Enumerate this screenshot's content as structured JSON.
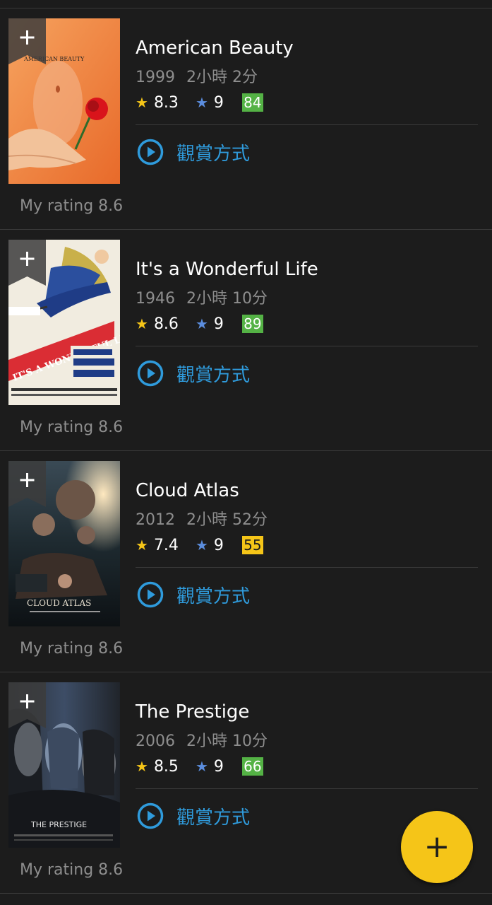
{
  "movies": [
    {
      "title": "American Beauty",
      "year": "1999",
      "runtime": "2小時 2分",
      "imdb_rating": "8.3",
      "user_rating": "9",
      "metascore": "84",
      "metascore_color": "#54b245",
      "watch_label": "觀賞方式",
      "my_rating": "My rating 8.6",
      "poster_text": "AMERICAN BEAUTY"
    },
    {
      "title": "It's a Wonderful Life",
      "year": "1946",
      "runtime": "2小時 10分",
      "imdb_rating": "8.6",
      "user_rating": "9",
      "metascore": "89",
      "metascore_color": "#54b245",
      "watch_label": "觀賞方式",
      "my_rating": "My rating 8.6",
      "poster_text": "IT'S A WONDERFUL LIFE"
    },
    {
      "title": "Cloud Atlas",
      "year": "2012",
      "runtime": "2小時 52分",
      "imdb_rating": "7.4",
      "user_rating": "9",
      "metascore": "55",
      "metascore_color": "#f5c518",
      "watch_label": "觀賞方式",
      "my_rating": "My rating 8.6",
      "poster_text": "CLOUD ATLAS"
    },
    {
      "title": "The Prestige",
      "year": "2006",
      "runtime": "2小時 10分",
      "imdb_rating": "8.5",
      "user_rating": "9",
      "metascore": "66",
      "metascore_color": "#54b245",
      "watch_label": "觀賞方式",
      "my_rating": "My rating 8.6",
      "poster_text": "THE PRESTIGE"
    }
  ],
  "icons": {
    "watchlist_add": "plus-ribbon-icon",
    "imdb_star": "star-icon",
    "user_star": "star-icon",
    "watch": "play-circle-icon",
    "fab": "plus-icon"
  },
  "fab_label": "+",
  "colors": {
    "background": "#1c1c1c",
    "accent": "#f5c518",
    "link": "#2f9bdc",
    "user_star": "#5b8dde"
  }
}
